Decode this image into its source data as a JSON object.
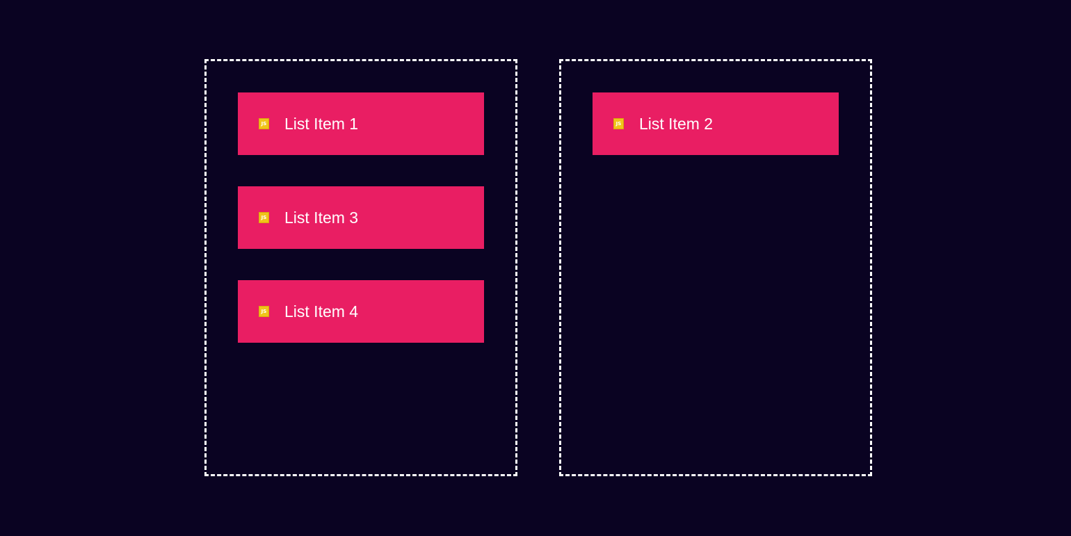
{
  "columns": [
    {
      "items": [
        {
          "label": "List Item 1",
          "icon": "js-file-icon",
          "icon_text": "JS"
        },
        {
          "label": "List Item 3",
          "icon": "js-file-icon",
          "icon_text": "JS"
        },
        {
          "label": "List Item 4",
          "icon": "js-file-icon",
          "icon_text": "JS"
        }
      ]
    },
    {
      "items": [
        {
          "label": "List Item 2",
          "icon": "js-file-icon",
          "icon_text": "JS"
        }
      ]
    }
  ],
  "colors": {
    "background": "#0a0322",
    "item": "#e91e63",
    "icon": "#f0c419",
    "border": "#ffffff"
  }
}
